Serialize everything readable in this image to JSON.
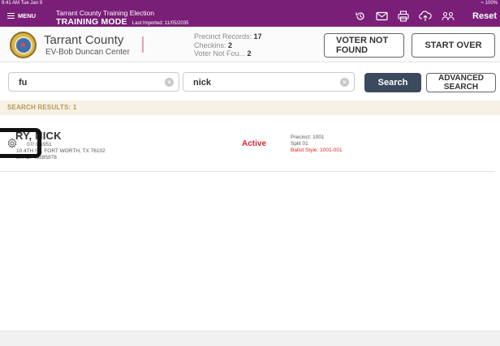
{
  "status_bar": {
    "time": "9:41 AM",
    "date": "Tue Jan 9",
    "battery": "100%"
  },
  "header_bar": {
    "menu_label": "MENU",
    "election_title": "Tarrant County Training Election",
    "mode_label": "TRAINING MODE",
    "last_imported": "Last Imported: 11/05/2035",
    "reset_label": "Reset",
    "icons": [
      "history-icon",
      "mail-icon",
      "printer-icon",
      "cloud-upload-icon",
      "users-icon"
    ]
  },
  "location": {
    "county": "Tarrant County",
    "center": "EV-Bob Duncan Center",
    "stats": [
      {
        "label": "Precinct Records:",
        "value": "17"
      },
      {
        "label": "Checkins:",
        "value": "2"
      },
      {
        "label": "Voter Not Fou...",
        "value": "2"
      }
    ]
  },
  "actions": {
    "voter_not_found": "VOTER NOT FOUND",
    "start_over": "START OVER"
  },
  "search": {
    "last_name_value": "fu",
    "first_name_value": "nick",
    "search_label": "Search",
    "advanced_label": "ADVANCED SEARCH"
  },
  "results": {
    "label": "SEARCH RESULTS: 1",
    "items": [
      {
        "name": "RY, NICK",
        "dob": "07/ 8/1951",
        "address": "10   4TH ST, FORT WORTH, TX 76102",
        "voter_id": "ER ID: 40285978",
        "status": "Active",
        "precinct": "Precinct: 1001",
        "split": "Split 01",
        "ballot_style": "Ballot Style: 1001-001"
      }
    ]
  },
  "colors": {
    "brand_purple": "#7a1f78",
    "search_button": "#3d4a5e",
    "status_active": "#e1242e",
    "results_bar": "#f6f1e4",
    "results_label": "#b29b52"
  }
}
